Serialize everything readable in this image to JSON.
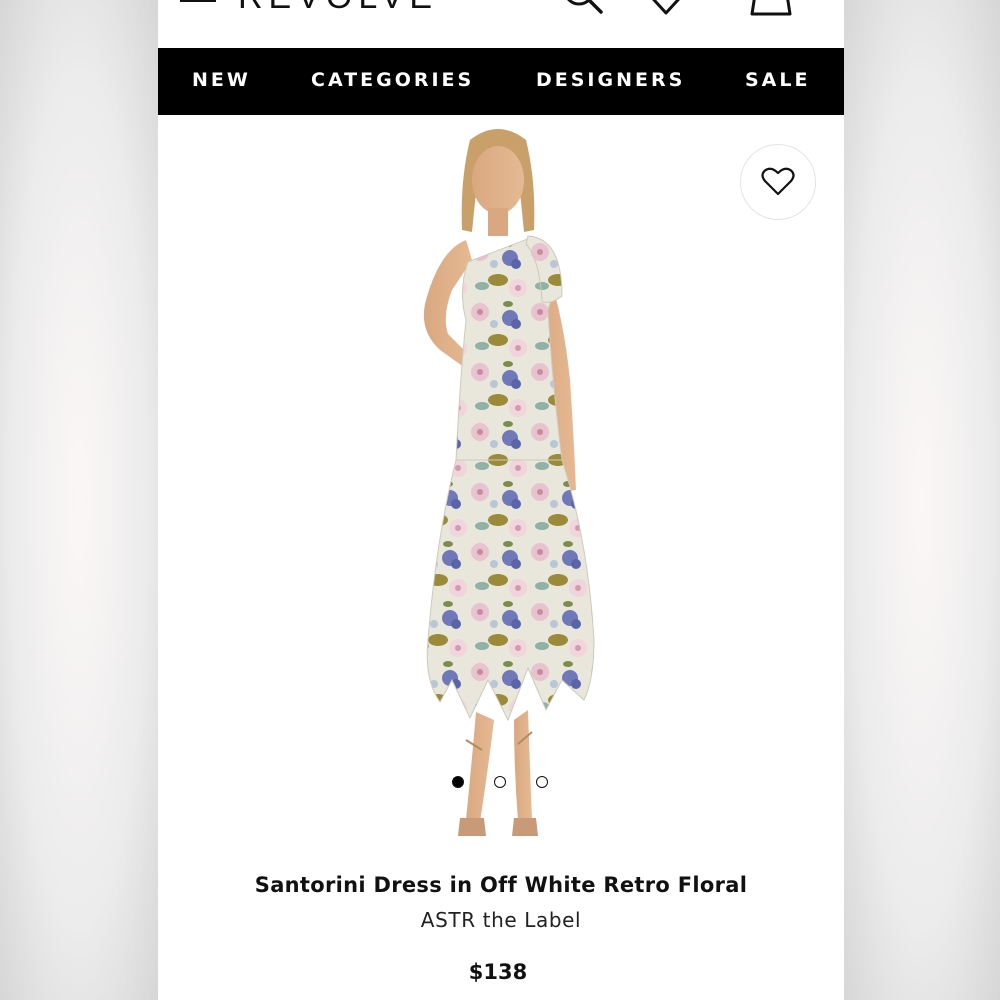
{
  "header": {
    "brand": "REVOLVE",
    "icons": [
      "menu-icon",
      "search-icon",
      "heart-icon",
      "bag-icon"
    ]
  },
  "nav": {
    "items": [
      {
        "label": "NEW"
      },
      {
        "label": "CATEGORIES"
      },
      {
        "label": "DESIGNERS"
      },
      {
        "label": "SALE"
      }
    ]
  },
  "product": {
    "title": "Santorini Dress in Off White Retro Floral",
    "brand": "ASTR the Label",
    "price": "$138",
    "image_count": 3,
    "active_image": 1
  },
  "colors": {
    "nav_background": "#000000",
    "nav_text": "#ffffff",
    "text": "#111111"
  }
}
